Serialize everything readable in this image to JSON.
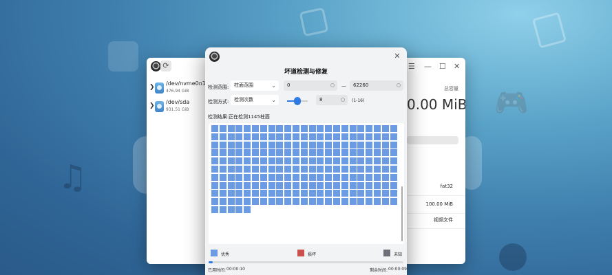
{
  "background_window": {
    "devices": [
      {
        "name": "/dev/nvme0n1",
        "size": "476.94 GiB"
      },
      {
        "name": "/dev/sda",
        "size": "931.51 GiB"
      }
    ],
    "window_controls": {
      "menu": "☰",
      "minimize": "—",
      "maximize": "☐",
      "close": "✕"
    },
    "capacity_label": "总容量",
    "capacity_value": "0.00 MiB",
    "info_values": [
      "fat32",
      "100.00 MiB",
      "视频文件"
    ]
  },
  "dialog": {
    "title": "坏道检测与修复",
    "close_glyph": "✕",
    "check_range_label": "检测范围:",
    "check_range_option": "柱面范围",
    "range_start": "0",
    "range_separator": "—",
    "range_end": "62260",
    "check_method_label": "检测方式:",
    "check_method_option": "检测次数",
    "slider_value": 0.5,
    "times_value": "8",
    "times_hint": "(1-16)",
    "result_label": "检测结果:",
    "result_text": "正在检测1145柱面",
    "cells_total_checked": 235,
    "legend": [
      {
        "label": "优秀",
        "color": "#6a9be3"
      },
      {
        "label": "损坏",
        "color": "#c9524e"
      },
      {
        "label": "未知",
        "color": "#6f6f7a"
      }
    ],
    "progress": 0.02,
    "elapsed_label": "已用时间:",
    "elapsed_value": "00:00:10",
    "remaining_label": "剩余时间:",
    "remaining_value": "00:00:09"
  }
}
